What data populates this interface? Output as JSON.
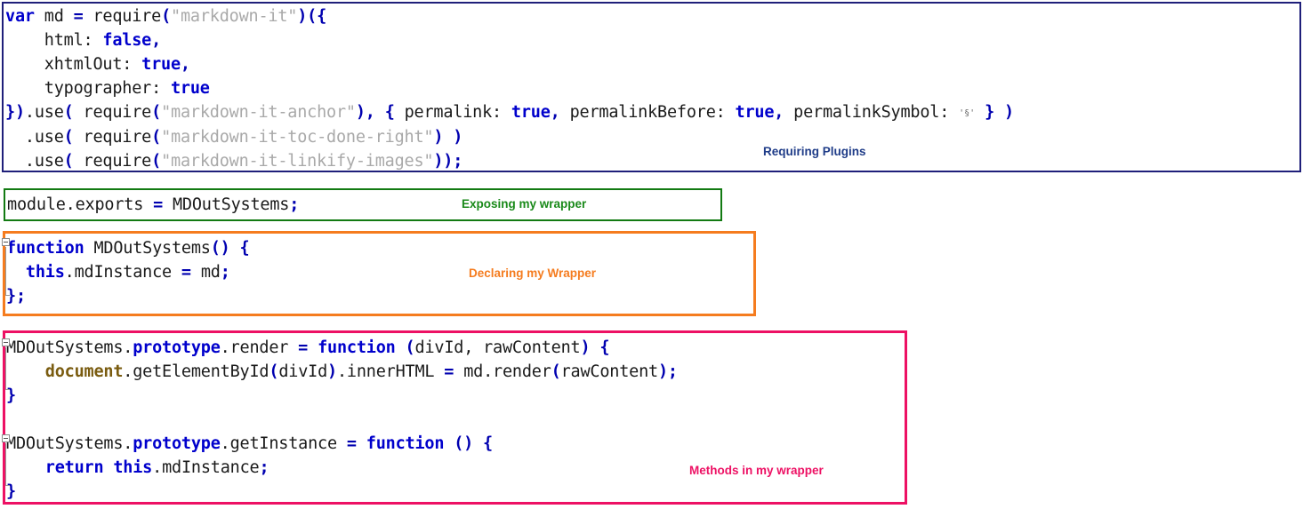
{
  "colors": {
    "block1_border": "#1f1f7a",
    "block2_border": "#127a12",
    "block3_border": "#f57c1f",
    "block4_border": "#ed1164",
    "keyword": "#0000cc",
    "string": "#a9a9a9",
    "document_token": "#7a5c10",
    "annotation_blue": "#1f3c88",
    "annotation_green": "#1a8a1a",
    "annotation_orange": "#f57c1f",
    "annotation_pink": "#ed1164"
  },
  "blocks": [
    {
      "id": "require-plugins-block",
      "border_color": "#1f1f7a",
      "lines": [
        "var md = require(\"markdown-it\")({",
        "    html: false,",
        "    xhtmlOut: true,",
        "    typographer: true",
        "}).use( require(\"markdown-it-anchor\"), { permalink: true, permalinkBefore: true, permalinkSymbol: '§' } )",
        "  .use( require(\"markdown-it-toc-done-right\") )",
        "  .use( require(\"markdown-it-linkify-images\"));"
      ],
      "annotation": "Requiring Plugins"
    },
    {
      "id": "module-exports-block",
      "border_color": "#127a12",
      "lines": [
        "module.exports = MDOutSystems;"
      ],
      "annotation": "Exposing my wrapper"
    },
    {
      "id": "constructor-block",
      "border_color": "#f57c1f",
      "lines": [
        "function MDOutSystems() {",
        "  this.mdInstance = md;",
        "};"
      ],
      "annotation": "Declaring my Wrapper"
    },
    {
      "id": "prototype-methods-block",
      "border_color": "#ed1164",
      "lines": [
        "MDOutSystems.prototype.render = function (divId, rawContent) {",
        "    document.getElementById(divId).innerHTML = md.render(rawContent);",
        "}",
        "",
        "MDOutSystems.prototype.getInstance = function () {",
        "    return this.mdInstance;",
        "}"
      ],
      "annotation": "Methods in my wrapper"
    }
  ],
  "annotations": {
    "requiring_plugins": "Requiring Plugins",
    "exposing_my_wrapper": "Exposing my wrapper",
    "declaring_my_wrapper": "Declaring my Wrapper",
    "methods_in_my_wrapper": "Methods in my wrapper"
  },
  "tokens": {
    "kw_var": "var",
    "kw_function": "function",
    "kw_true": "true",
    "kw_false": "false",
    "kw_this": "this",
    "kw_return": "return",
    "kw_prototype": "prototype",
    "kw_document": "document",
    "str_markdown_it": "\"markdown-it\"",
    "str_markdown_it_anchor": "\"markdown-it-anchor\"",
    "str_markdown_it_toc": "\"markdown-it-toc-done-right\"",
    "str_markdown_it_linkify": "\"markdown-it-linkify-images\"",
    "permalink_symbol": "'§'"
  },
  "icons": {
    "fold_collapse": "fold-collapse-icon"
  }
}
